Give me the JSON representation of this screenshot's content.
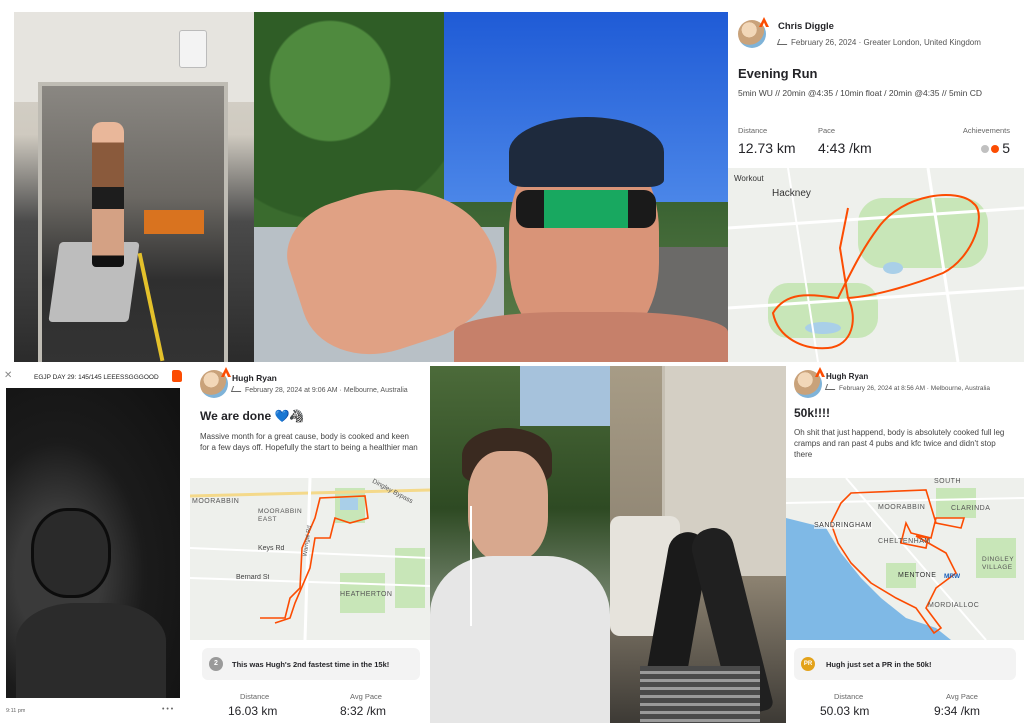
{
  "panel1": {
    "description": ""
  },
  "card1": {
    "athlete": "Chris Diggle",
    "meta": "February 26, 2024 · Greater London, United Kingdom",
    "title": "Evening Run",
    "description": "5min WU // 20min @4:35 / 10min float / 20min @4:35 // 5min CD",
    "stats": [
      {
        "label": "Distance",
        "value": "12.73 km"
      },
      {
        "label": "Pace",
        "value": "4:43 /km"
      },
      {
        "label": "Achievements",
        "value": "5"
      }
    ],
    "map_tag": "Workout",
    "map_places": [
      "Hackney"
    ],
    "colors": {
      "route": "#fc4c02",
      "park": "#c8e6b8",
      "water": "#a9cfe8"
    }
  },
  "story": {
    "caption": "EGJP DAY 29: 145/145 LEEESSGGGOOD",
    "time": "9:11 pm",
    "dots": "• • •",
    "close": "✕"
  },
  "card2": {
    "athlete": "Hugh Ryan",
    "meta": "February 28, 2024 at 9:06 AM · Melbourne, Australia",
    "title": "We are done 💙🦓",
    "description": "Massive month for a great cause, body is cooked and keen for a few days off. Hopefully the start to being a healthier man",
    "map_places": [
      "MOORABBIN",
      "MOORABBIN EAST",
      "Keys Rd",
      "Bernard St",
      "HEATHERTON",
      "Dingley Bypass",
      "Warrigal Rd"
    ],
    "achievement_medal": "2",
    "achievement": "This was Hugh's 2nd fastest time in the 15k!",
    "stats": [
      {
        "label": "Distance",
        "value": "16.03 km"
      },
      {
        "label": "Avg Pace",
        "value": "8:32 /km"
      }
    ]
  },
  "card3": {
    "athlete": "Hugh Ryan",
    "meta": "February 26, 2024 at 8:56 AM · Melbourne, Australia",
    "title": "50k!!!!",
    "description": "Oh shit that just happend, body is absolutely cooked full leg cramps and ran past 4 pubs and kfc twice and didn't stop there",
    "map_places": [
      "SOUTH",
      "MOORABBIN",
      "CLARINDA",
      "SANDRINGHAM",
      "CHELTENHAM",
      "DINGLEY VILLAGE",
      "MENTONE",
      "MRW",
      "MORDIALLOC"
    ],
    "achievement_medal": "PR",
    "achievement": "Hugh just set a PR in the 50k!",
    "stats": [
      {
        "label": "Distance",
        "value": "50.03 km"
      },
      {
        "label": "Avg Pace",
        "value": "9:34 /km"
      }
    ]
  }
}
